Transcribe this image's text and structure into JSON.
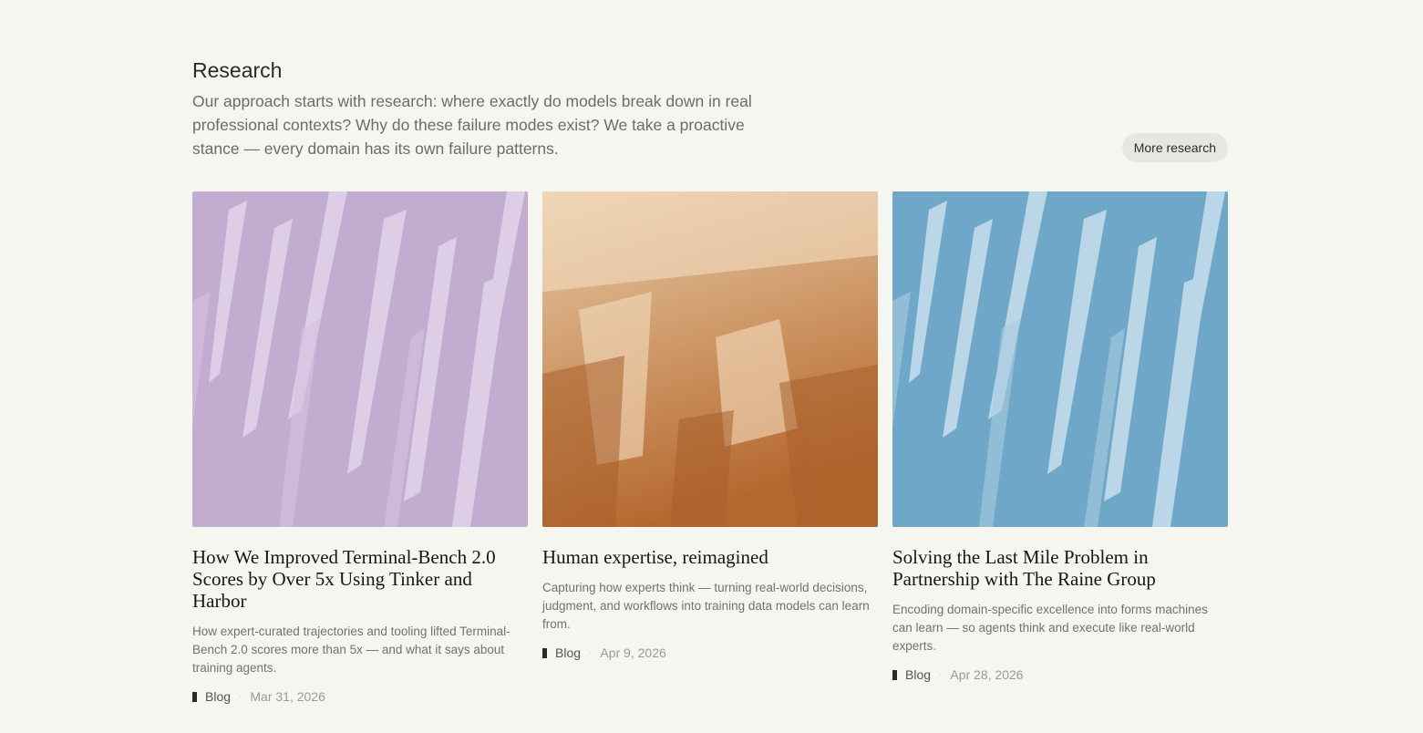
{
  "research": {
    "title": "Research",
    "intro": "Our approach starts with research: where exactly do models break down in real professional contexts? Why do these failure modes exist? We take a proactive stance — every domain has its own failure patterns.",
    "more_button": "More research"
  },
  "cards": [
    {
      "title": "How We Improved Terminal-Bench 2.0 Scores by Over 5x Using Tinker and Harbor",
      "description": "How expert-curated trajectories and tooling lifted Terminal-Bench 2.0 scores more than 5x — and what it says about training agents.",
      "category": "Blog",
      "date": "Mar 31, 2026",
      "image_color": "#c2acd0"
    },
    {
      "title": "Human expertise, reimagined",
      "description": "Capturing how experts think — turning real-world decisions, judgment, and workflows into training data models can learn from.",
      "category": "Blog",
      "date": "Apr 9, 2026",
      "image_color": "#b9743f"
    },
    {
      "title": "Solving the Last Mile Problem in Partnership with The Raine Group",
      "description": "Encoding domain-specific excellence into forms machines can learn — so agents think and execute like real-world experts.",
      "category": "Blog",
      "date": "Apr 28, 2026",
      "image_color": "#6fa7c9"
    }
  ]
}
